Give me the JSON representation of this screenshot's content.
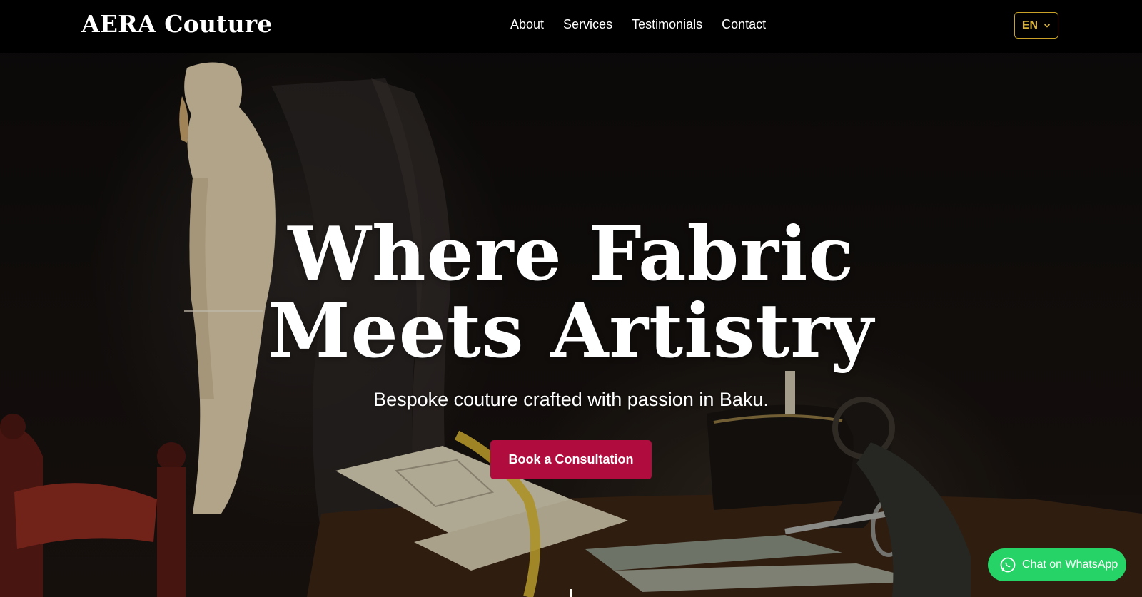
{
  "brand": {
    "name": "AERA Couture"
  },
  "nav": {
    "links": [
      {
        "label": "About"
      },
      {
        "label": "Services"
      },
      {
        "label": "Testimonials"
      },
      {
        "label": "Contact"
      }
    ]
  },
  "language": {
    "selected": "EN",
    "icon": "chevron-down-icon"
  },
  "hero": {
    "headline_line1": "Where Fabric",
    "headline_line2": "Meets Artistry",
    "subheadline": "Bespoke couture crafted with passion in Baku.",
    "cta_label": "Book a Consultation",
    "background": "tailor workshop photo: dress form, open sketchbook, measuring tape, antique sewing machine, scissors"
  },
  "whatsapp": {
    "label": "Chat on WhatsApp",
    "icon": "whatsapp-icon"
  },
  "colors": {
    "nav_background": "#000000",
    "accent_gold": "#c9a227",
    "cta_crimson": "#b00d3e",
    "whatsapp_green": "#25d366",
    "text": "#ffffff"
  }
}
